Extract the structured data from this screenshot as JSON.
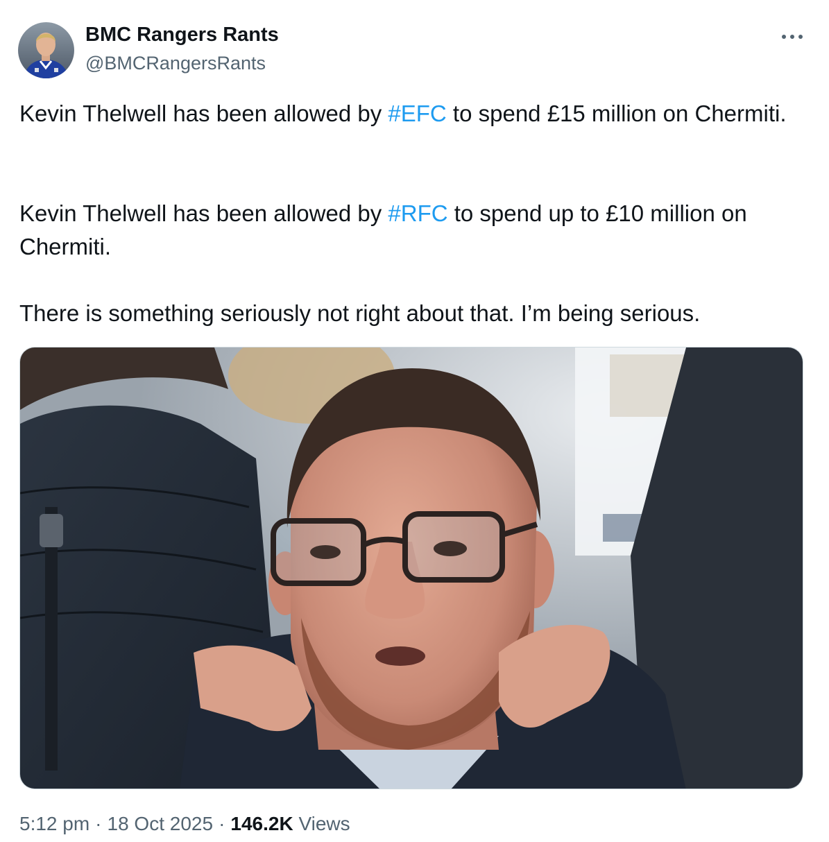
{
  "author": {
    "display_name": "BMC Rangers Rants",
    "handle": "@BMCRangersRants"
  },
  "tweet": {
    "paragraphs": [
      {
        "before": "Kevin Thelwell has been allowed by ",
        "hashtag": "#EFC",
        "after": " to spend £15 million on Chermiti."
      },
      {
        "before": "Kevin Thelwell has been allowed by ",
        "hashtag": "#RFC",
        "after": " to spend up to £10 million on Chermiti."
      },
      {
        "text": "There is something seriously not right about that. I’m being serious."
      }
    ]
  },
  "meta": {
    "time": "5:12 pm",
    "separator": "·",
    "date": "18 Oct 2025",
    "views_count": "146.2K",
    "views_label": "Views"
  },
  "colors": {
    "text": "#0f1419",
    "secondary": "#536471",
    "link": "#1d9bf0",
    "border": "#cfd9de"
  },
  "icons": {
    "more": "more-horizontal-icon"
  }
}
